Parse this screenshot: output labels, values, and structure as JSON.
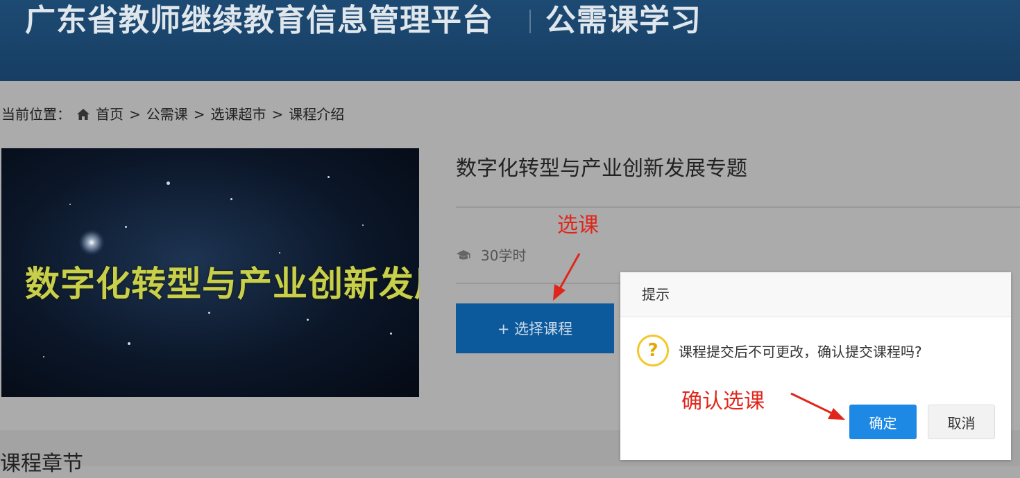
{
  "header": {
    "title": "广东省教师继续教育信息管理平台",
    "subtitle": "公需课学习"
  },
  "breadcrumb": {
    "label": "当前位置：",
    "items": [
      "首页",
      "公需课",
      "选课超市",
      "课程介绍"
    ],
    "separator": ">"
  },
  "course": {
    "image_text": "数字化转型与产业创新发展",
    "title": "数字化转型与产业创新发展专题",
    "hours": "30学时",
    "select_button": "+ 选择课程"
  },
  "section": {
    "title": "课程章节"
  },
  "dialog": {
    "title": "提示",
    "message": "课程提交后不可更改，确认提交课程吗?",
    "ok_label": "确定",
    "cancel_label": "取消"
  },
  "annotations": {
    "select_note": "选课",
    "confirm_note": "确认选课"
  },
  "colors": {
    "header_bg": "#1b4670",
    "primary_button": "#0c5a9c",
    "confirm_button": "#1e88e5",
    "annotation_red": "#e0261c",
    "warning_icon": "#f3c82c"
  },
  "icons": {
    "breadcrumb": "home-icon",
    "hours": "graduation-cap-icon",
    "dialog": "question-icon"
  }
}
